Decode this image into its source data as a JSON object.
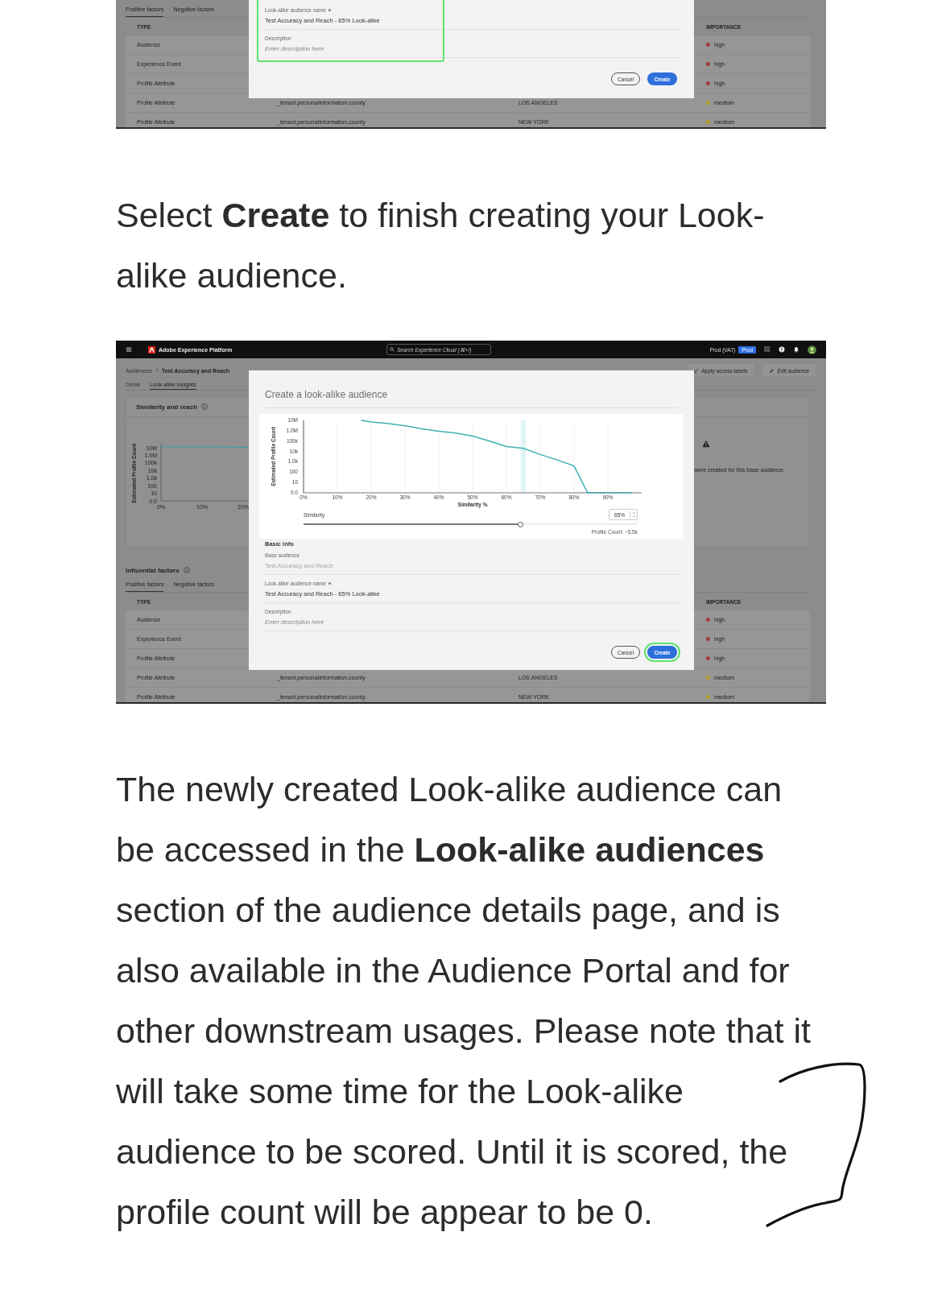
{
  "content": [
    {
      "kind": "screenshot",
      "influential": {
        "factor_tabs": [
          {
            "label": "Positive factors",
            "selected": true
          },
          {
            "label": "Negative factors",
            "selected": false
          }
        ],
        "table": {
          "columns": [
            "TYPE",
            "IMPORTANCE"
          ],
          "rows": [
            {
              "type": "Audience",
              "importance": "high",
              "color": "#a33b3b"
            },
            {
              "type": "Experience Event",
              "importance": "high",
              "color": "#a33b3b"
            },
            {
              "type": "Profile Attribute",
              "importance": "high",
              "color": "#a33b3b"
            },
            {
              "type": "Profile Attribute",
              "column_2": "_tenant.personalInformation.county",
              "column_3": "LOS ANGELES",
              "importance": "medium",
              "color": "#b39a2c"
            },
            {
              "type": "Profile Attribute",
              "column_2": "_tenant.personalInformation.county",
              "column_3": "NEW YORK",
              "importance": "medium",
              "color": "#b39a2c"
            }
          ]
        }
      },
      "modal": {
        "fields": [
          {
            "label": "Look-alike audience name",
            "required": true,
            "disabled": false,
            "value": "Test Accuracy and Reach - 65% Look-alike"
          },
          {
            "label": "Description",
            "required": false,
            "disabled": false,
            "placeholder": "Enter description here"
          }
        ],
        "fields_highlighted": true,
        "buttons": [
          {
            "label": "Cancel",
            "kind": "secondary",
            "highlighted": false
          },
          {
            "label": "Create",
            "kind": "primary",
            "highlighted": false
          }
        ]
      }
    },
    {
      "kind": "paragraph",
      "text": "Select **Create** to finish creating your Look-alike audience."
    },
    {
      "kind": "screenshot",
      "header": {
        "app_name": "Adobe Experience Platform",
        "search_placeholder": "Search Experience Cloud (⌘+/)",
        "sandbox": "Prod (VA7)",
        "sandbox_badge": "Prod"
      },
      "breadcrumb": [
        "Audiences",
        "Test Accuracy and Reach"
      ],
      "actions": [
        {
          "label": "Apply access labels",
          "kind": "labels"
        },
        {
          "label": "Edit audience",
          "kind": "edit"
        }
      ],
      "page_tabs": [
        {
          "label": "Detail",
          "selected": false
        },
        {
          "label": "Look-alike insights",
          "selected": true
        }
      ],
      "similarity_card": {
        "title": "Similarity and reach",
        "notice": "were created for this base audience.",
        "chart": {
          "ylabel": "Estimated Profile Count",
          "y_labels": [
            "10M",
            "1.0M",
            "100k",
            "10k",
            "1.0k",
            "100",
            "10",
            "0.0"
          ],
          "x_labels": [
            "0%",
            "10%",
            "20%"
          ]
        }
      },
      "influential": {
        "title": "Influential factors",
        "factor_tabs": [
          {
            "label": "Positive factors",
            "selected": true
          },
          {
            "label": "Negative factors",
            "selected": false
          }
        ],
        "table": {
          "columns": [
            "TYPE",
            "IMPORTANCE"
          ],
          "rows": [
            {
              "type": "Audience",
              "importance": "high",
              "color": "#a33b3b"
            },
            {
              "type": "Experience Event",
              "importance": "high",
              "color": "#a33b3b"
            },
            {
              "type": "Profile Attribute",
              "importance": "high",
              "color": "#a33b3b"
            },
            {
              "type": "Profile Attribute",
              "column_2": "_tenant.personalInformation.county",
              "column_3": "LOS ANGELES",
              "importance": "medium",
              "color": "#b39a2c"
            },
            {
              "type": "Profile Attribute",
              "column_2": "_tenant.personalInformation.county",
              "column_3": "NEW YORK",
              "importance": "medium",
              "color": "#b39a2c"
            }
          ]
        }
      },
      "modal": {
        "title": "Create a look-alike audience",
        "chart": {
          "xlabel": "Similarity %",
          "ylabel": "Estimated Profile Count",
          "y_labels": [
            "10M",
            "1.0M",
            "100k",
            "10k",
            "1.0k",
            "100",
            "10",
            "0.0"
          ],
          "x_labels": [
            "0%",
            "10%",
            "20%",
            "30%",
            "40%",
            "50%",
            "60%",
            "70%",
            "80%",
            "90%"
          ]
        },
        "slider": {
          "label": "Similarity",
          "level": 0.65,
          "value": "65%"
        },
        "profile_count": "Profile Count: ~5.5k",
        "section_title": "Basic info",
        "fields": [
          {
            "label": "Base audience",
            "required": false,
            "disabled": true,
            "value": "Test Accuracy and Reach"
          },
          {
            "label": "Look-alike audience name",
            "required": true,
            "disabled": false,
            "value": "Test Accuracy and Reach - 65% Look-alike"
          },
          {
            "label": "Description",
            "required": false,
            "disabled": false,
            "placeholder": "Enter description here"
          }
        ],
        "fields_highlighted": false,
        "buttons": [
          {
            "label": "Cancel",
            "kind": "secondary",
            "highlighted": false
          },
          {
            "label": "Create",
            "kind": "primary",
            "highlighted": true
          }
        ]
      }
    },
    {
      "kind": "paragraph",
      "text": "The newly created Look-alike audience can be accessed in the **Look-alike audiences** section of the audience details page, and is also available in the Audience Portal and for other downstream usages. Please note that it will take some time for the Look-alike audience to be scored. Until it is scored, the profile count will be appear to be 0."
    }
  ]
}
